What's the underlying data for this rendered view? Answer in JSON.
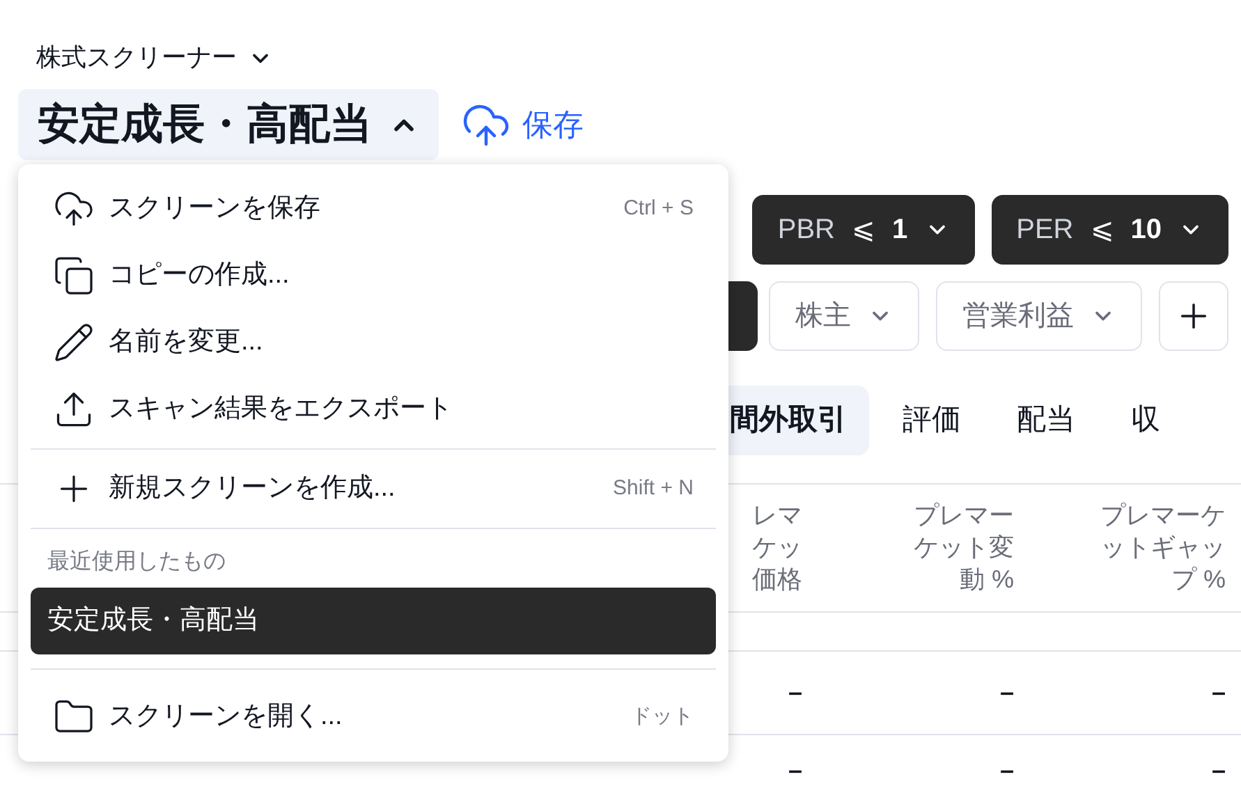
{
  "breadcrumb": {
    "label": "株式スクリーナー"
  },
  "screen_title": {
    "label": "安定成長・高配当",
    "expanded": true
  },
  "save_button": {
    "label": "保存"
  },
  "filters_row_1": [
    {
      "label": "PBR",
      "operator": "⩽",
      "value": "1",
      "active": true
    },
    {
      "label": "PER",
      "operator": "⩽",
      "value": "10",
      "active": true
    }
  ],
  "filters_row_2": [
    {
      "label": "株主",
      "active": false
    },
    {
      "label": "営業利益",
      "active": false
    }
  ],
  "tabs": [
    {
      "label": "間外取引",
      "selected": true
    },
    {
      "label": "評価",
      "selected": false
    },
    {
      "label": "配当",
      "selected": false
    },
    {
      "label": "収",
      "selected": false
    }
  ],
  "table": {
    "columns": [
      "レマケッ価格",
      "プレマーケット変動 %",
      "プレマーケットギャップ %"
    ],
    "rows": [
      [
        "–",
        "–",
        "–"
      ],
      [
        "–",
        "–",
        "–"
      ]
    ]
  },
  "menu": {
    "actions": [
      {
        "label": "スクリーンを保存",
        "shortcut": "Ctrl + S"
      },
      {
        "label": "コピーの作成..."
      },
      {
        "label": "名前を変更..."
      },
      {
        "label": "スキャン結果をエクスポート"
      }
    ],
    "new_item": {
      "label": "新規スクリーンを作成...",
      "shortcut": "Shift + N"
    },
    "recent_heading": "最近使用したもの",
    "recent": [
      {
        "label": "安定成長・高配当",
        "selected": true
      }
    ],
    "open_item": {
      "label": "スクリーンを開く...",
      "shortcut": "ドット"
    }
  }
}
